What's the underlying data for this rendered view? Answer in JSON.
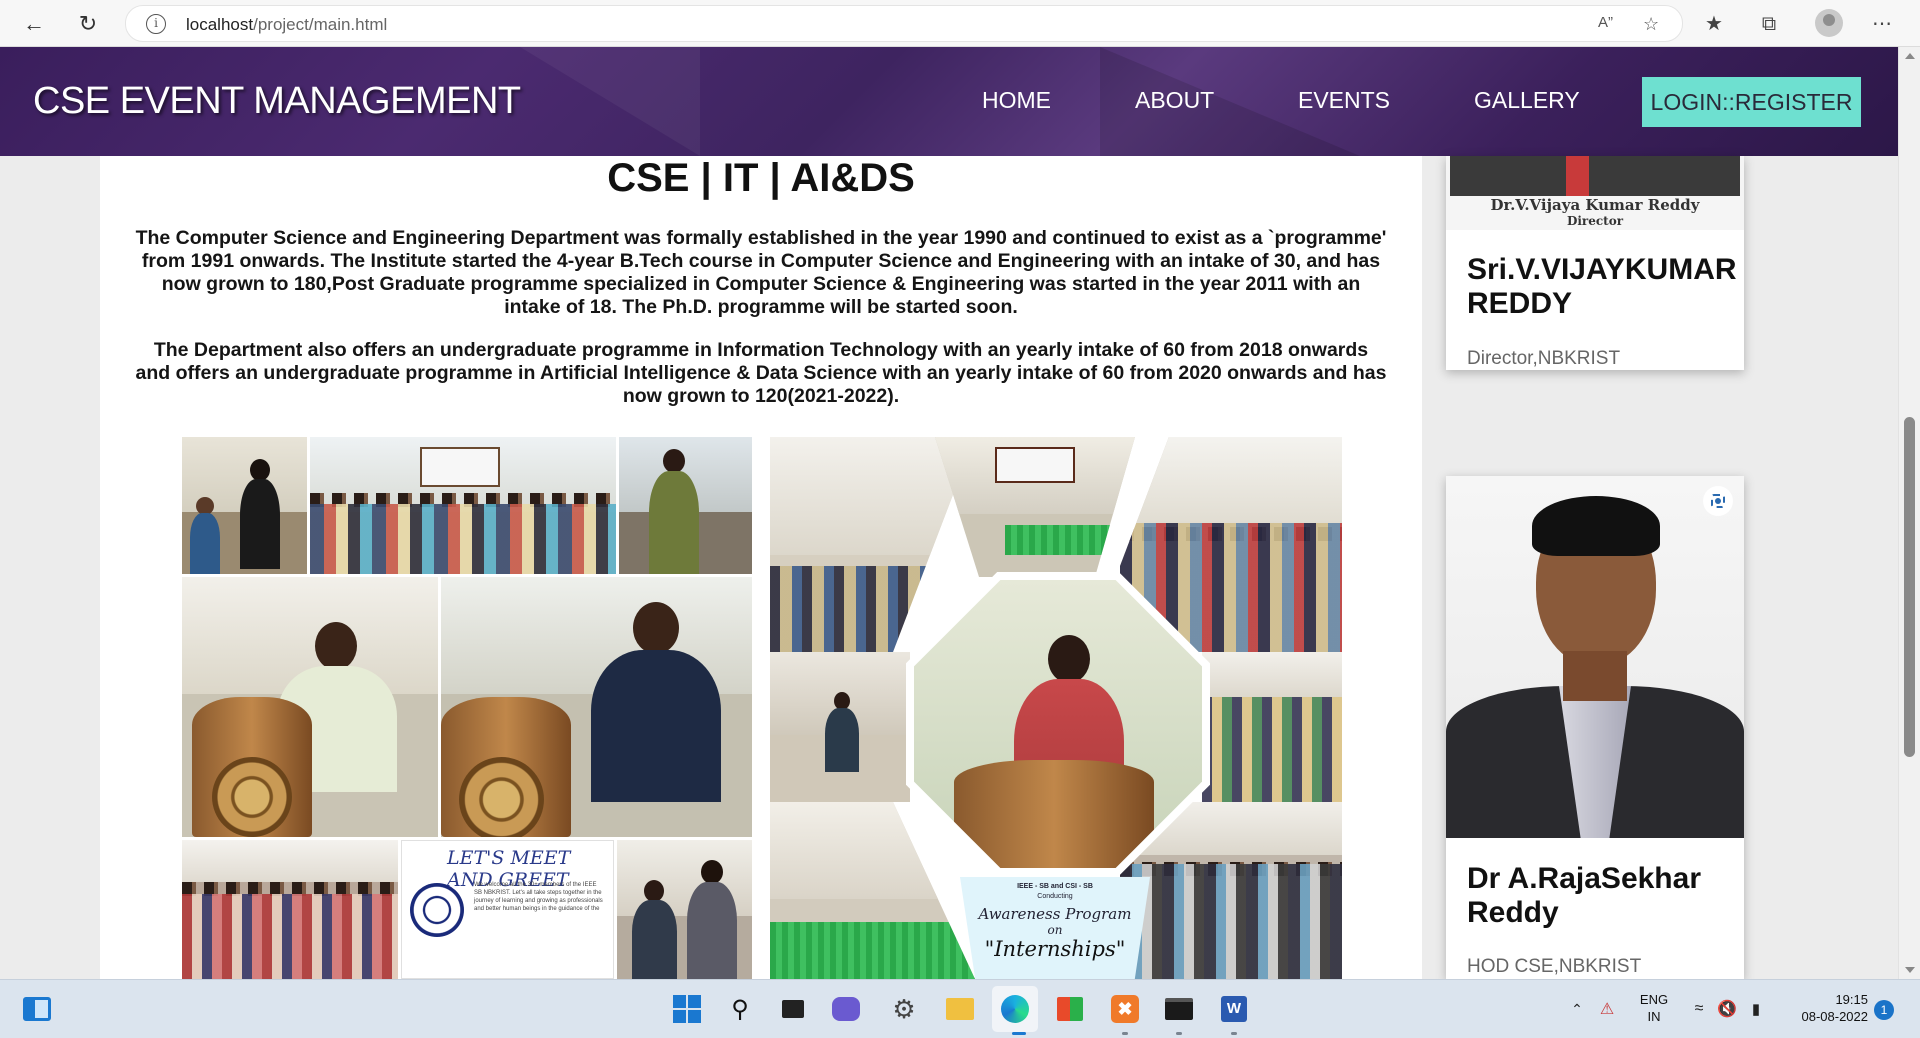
{
  "browser": {
    "url_host": "localhost",
    "url_path": "/project/main.html"
  },
  "header": {
    "brand": "CSE EVENT MANAGEMENT",
    "nav": [
      "HOME",
      "ABOUT",
      "EVENTS",
      "GALLERY"
    ],
    "login_label": "LOGIN::REGISTER",
    "login_color": "#6ee0d0"
  },
  "main": {
    "title": "CSE | IT | AI&DS",
    "paragraph1": "The Computer Science and Engineering Department was formally established in the year 1990 and continued to exist as a `programme' from 1991 onwards. The Institute started the 4-year B.Tech course in Computer Science and Engineering with an intake of 30, and has now grown to 180,Post Graduate programme specialized in Computer Science & Engineering was started in the year 2011 with an intake of 18. The Ph.D. programme will be started soon.",
    "paragraph2": "The Department also offers an undergraduate programme in Information Technology with an yearly intake of 60 from 2018 onwards and offers an undergraduate programme in Artificial Intelligence & Data Science with an yearly intake of 60 from 2020 onwards and has now grown to 120(2021-2022).",
    "collage_left": {
      "meet_title": "LET'S MEET AND GREET",
      "meet_text": "We welcome all the 30+ members of the IEEE SB NBKRIST. Let's all take steps together in the journey of learning and growing as professionals and better human beings in the guidance of the"
    },
    "collage_right": {
      "small_text": "IEEE - SB and CSI - SB",
      "conducting": "Conducting",
      "program_line1": "Awareness Program",
      "program_line2": "on",
      "program_line3": "\"Internships\""
    }
  },
  "sidebar": {
    "cards": [
      {
        "photo_caption": "Dr.V.Vijaya Kumar Reddy",
        "photo_caption_sub": "Director",
        "name": "Sri.V.VIJAYKUMAR REDDY",
        "role": "Director,NBKRIST"
      },
      {
        "name": "Dr A.RajaSekhar Reddy",
        "role": "HOD CSE,NBKRIST"
      }
    ]
  },
  "taskbar": {
    "lang_line1": "ENG",
    "lang_line2": "IN",
    "time": "19:15",
    "date": "08-08-2022",
    "notifications": "1"
  }
}
